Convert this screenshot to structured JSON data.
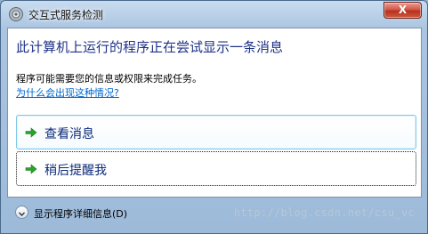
{
  "window": {
    "title": "交互式服务检测",
    "close_label": "X"
  },
  "main": {
    "heading": "此计算机上运行的程序正在尝试显示一条消息",
    "description": "程序可能需要您的信息或权限来完成任务。",
    "help_link": "为什么会出现这种情况?"
  },
  "commands": [
    {
      "label": "查看消息",
      "icon": "green-arrow-icon"
    },
    {
      "label": "稍后提醒我",
      "icon": "green-arrow-icon"
    }
  ],
  "footer": {
    "details_label": "显示程序详细信息(D)",
    "details_icon": "chevron-down-icon",
    "watermark": "http://blog.csdn.net/csu_vc"
  },
  "colors": {
    "heading": "#1e3287",
    "link": "#0066cc",
    "arrow": "#2aa32a",
    "close_button": "#c8432f"
  }
}
